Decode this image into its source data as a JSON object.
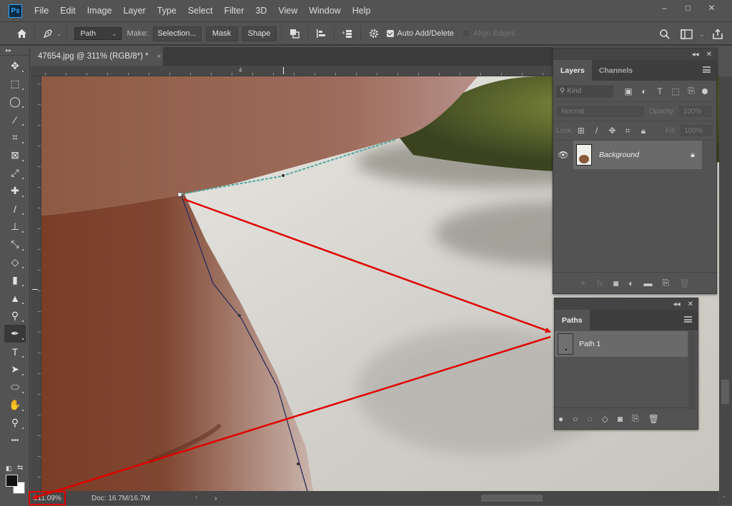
{
  "app": {
    "logo": "Ps",
    "name": "Adobe Photoshop"
  },
  "menu": [
    "File",
    "Edit",
    "Image",
    "Layer",
    "Type",
    "Select",
    "Filter",
    "3D",
    "View",
    "Window",
    "Help"
  ],
  "window_controls": {
    "minimize": "–",
    "maximize": "□",
    "close": "✕"
  },
  "options_bar": {
    "home_icon": "home-icon",
    "tool_icon": "pen-tool-icon",
    "mode_value": "Path",
    "make_label": "Make:",
    "selection_button": "Selection...",
    "mask_button": "Mask",
    "shape_button": "Shape",
    "auto_add_delete": {
      "label": "Auto Add/Delete",
      "checked": true
    },
    "align_edges": {
      "label": "Align Edges",
      "checked": false,
      "enabled": false
    }
  },
  "document": {
    "tab_title": "47654.jpg @ 311% (RGB/8*) *",
    "tab_close": "×",
    "ruler_top_label": "4"
  },
  "toolbar": {
    "tools": [
      {
        "name": "move",
        "glyph": "✥"
      },
      {
        "name": "marquee",
        "glyph": "⬚"
      },
      {
        "name": "lasso",
        "glyph": "◯"
      },
      {
        "name": "magic-wand",
        "glyph": "⁄"
      },
      {
        "name": "crop",
        "glyph": "⌗"
      },
      {
        "name": "frame",
        "glyph": "⊠"
      },
      {
        "name": "eyedropper",
        "glyph": "⤢"
      },
      {
        "name": "healing-brush",
        "glyph": "✚"
      },
      {
        "name": "brush",
        "glyph": "/"
      },
      {
        "name": "clone-stamp",
        "glyph": "⊥"
      },
      {
        "name": "history-brush",
        "glyph": "⤡"
      },
      {
        "name": "eraser",
        "glyph": "◇"
      },
      {
        "name": "gradient",
        "glyph": "▮"
      },
      {
        "name": "blur",
        "glyph": "▲"
      },
      {
        "name": "dodge",
        "glyph": "⚲"
      },
      {
        "name": "pen",
        "glyph": "✒",
        "active": true
      },
      {
        "name": "type",
        "glyph": "T"
      },
      {
        "name": "path-selection",
        "glyph": "➤"
      },
      {
        "name": "ellipse",
        "glyph": "⬭"
      },
      {
        "name": "hand",
        "glyph": "✋"
      },
      {
        "name": "zoom",
        "glyph": "⚲"
      },
      {
        "name": "edit-toolbar",
        "glyph": "•••"
      }
    ],
    "foreground_color": "#111111",
    "background_color": "#ffffff"
  },
  "layers_panel": {
    "tabs": [
      {
        "label": "Layers",
        "active": true
      },
      {
        "label": "Channels",
        "active": false
      }
    ],
    "kind_placeholder": "Kind",
    "blend_mode": "Normal",
    "opacity_label": "Opacity:",
    "opacity_value": "100%",
    "lock_label": "Lock:",
    "fill_label": "Fill:",
    "fill_value": "100%",
    "layers": [
      {
        "name": "Background",
        "visible": true,
        "locked": true
      }
    ]
  },
  "paths_panel": {
    "tabs": [
      {
        "label": "Paths",
        "active": true
      }
    ],
    "paths": [
      {
        "name": "Path 1"
      }
    ]
  },
  "status_bar": {
    "zoom": "311.09%",
    "doc_info": "Doc: 16.7M/16.7M"
  },
  "annotations": {
    "arrow_color": "#e00000",
    "highlight_color": "#e00000"
  }
}
